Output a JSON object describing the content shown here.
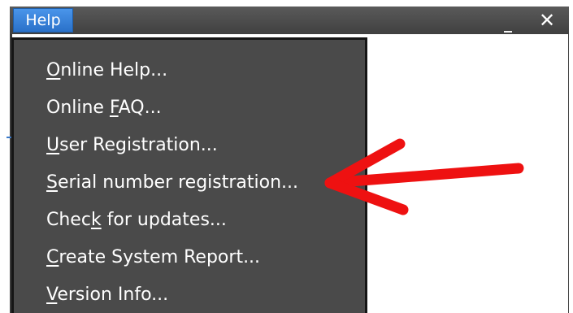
{
  "menubar": {
    "help_label": "Help",
    "minimize_glyph": "_",
    "close_glyph": "✕"
  },
  "help_menu": {
    "items": [
      {
        "pre": "",
        "mn": "O",
        "post": "nline Help..."
      },
      {
        "pre": "Online ",
        "mn": "F",
        "post": "AQ..."
      },
      {
        "pre": "",
        "mn": "U",
        "post": "ser Registration..."
      },
      {
        "pre": "",
        "mn": "S",
        "post": "erial number registration..."
      },
      {
        "pre": "Chec",
        "mn": "k",
        "post": " for updates..."
      },
      {
        "pre": "",
        "mn": "C",
        "post": "reate System Report..."
      },
      {
        "pre": "",
        "mn": "V",
        "post": "ersion Info..."
      }
    ]
  },
  "annotation": {
    "arrow_color": "#ee1111",
    "arrow_points_to": "Serial number registration..."
  }
}
